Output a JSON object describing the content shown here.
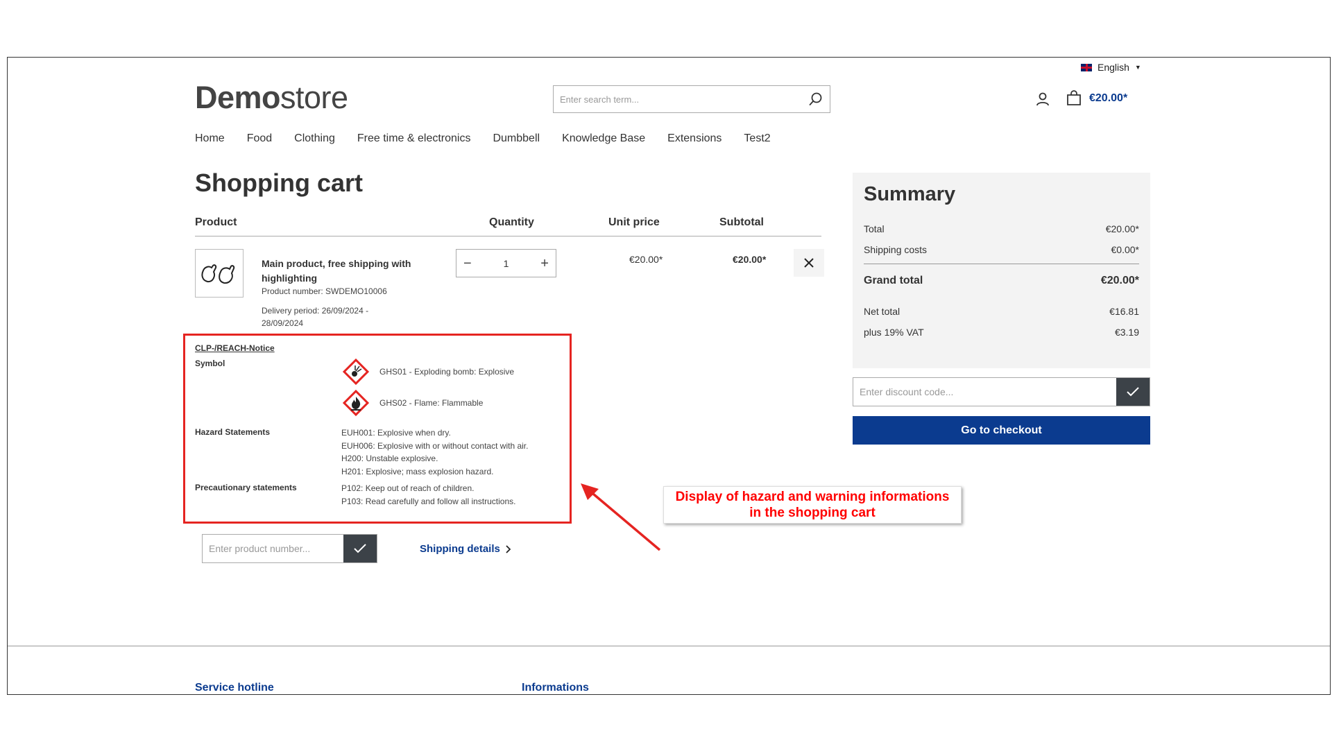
{
  "header": {
    "language": "English",
    "logo_bold": "Demo",
    "logo_light": "store",
    "search_placeholder": "Enter search term...",
    "cart_total": "€20.00*"
  },
  "nav": {
    "items": [
      "Home",
      "Food",
      "Clothing",
      "Free time & electronics",
      "Dumbbell",
      "Knowledge Base",
      "Extensions",
      "Test2"
    ]
  },
  "cart": {
    "title": "Shopping cart",
    "columns": {
      "product": "Product",
      "quantity": "Quantity",
      "unit_price": "Unit price",
      "subtotal": "Subtotal"
    },
    "item": {
      "name": "Main product, free shipping with highlighting",
      "product_number": "Product number: SWDEMO10006",
      "delivery": "Delivery period: 26/09/2024 - 28/09/2024",
      "quantity": "1",
      "unit_price": "€20.00*",
      "subtotal": "€20.00*"
    },
    "clp": {
      "title": "CLP-/REACH-Notice",
      "symbol_label": "Symbol",
      "symbols": [
        "GHS01 - Exploding bomb: Explosive",
        "GHS02 - Flame: Flammable"
      ],
      "hazard_label": "Hazard Statements",
      "hazard_statements": [
        "EUH001: Explosive when dry.",
        "EUH006: Explosive with or without contact with air.",
        "H200: Unstable explosive.",
        "H201: Explosive; mass explosion hazard."
      ],
      "precaution_label": "Precautionary statements",
      "precautionary_statements": [
        "P102: Keep out of reach of children.",
        "P103: Read carefully and follow all instructions."
      ]
    },
    "annotation": {
      "line1": "Display of hazard and warning informations",
      "line2": "in the shopping cart"
    },
    "product_number_placeholder": "Enter product number...",
    "shipping_details": "Shipping details"
  },
  "summary": {
    "title": "Summary",
    "total_label": "Total",
    "total_value": "€20.00*",
    "shipping_label": "Shipping costs",
    "shipping_value": "€0.00*",
    "grand_label": "Grand total",
    "grand_value": "€20.00*",
    "net_label": "Net total",
    "net_value": "€16.81",
    "vat_label": "plus 19% VAT",
    "vat_value": "€3.19",
    "discount_placeholder": "Enter discount code...",
    "checkout_label": "Go to checkout"
  },
  "footer": {
    "service_hotline": "Service hotline",
    "informations": "Informations"
  },
  "colors": {
    "brand": "#0b3b8f",
    "highlight": "#e52421"
  }
}
